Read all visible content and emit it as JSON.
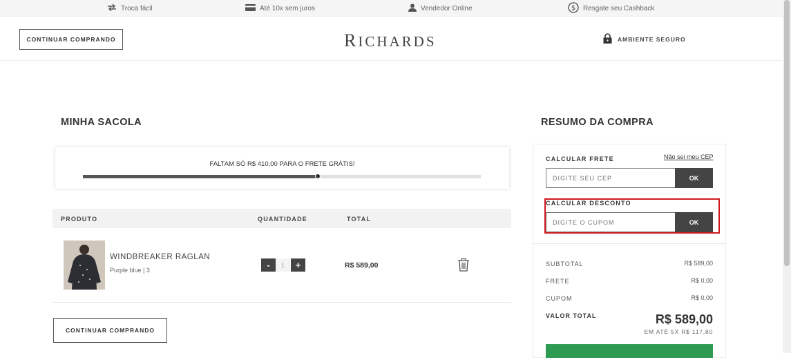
{
  "topbar": {
    "items": [
      {
        "label": "Troca fácil",
        "icon": "swap-arrows-icon"
      },
      {
        "label": "Até 10x sem juros",
        "icon": "credit-card-icon"
      },
      {
        "label": "Vendedor Online",
        "icon": "person-icon"
      },
      {
        "label": "Resgate seu Cashback",
        "icon": "dollar-coin-icon"
      }
    ]
  },
  "header": {
    "continue_label": "CONTINUAR COMPRANDO",
    "logo_first": "R",
    "logo_rest": "ICHARDS",
    "secure_label": "AMBIENTE SEGURO"
  },
  "bag": {
    "title": "MINHA SACOLA",
    "free_shipping_text": "FALTAM SÓ R$ 410,00 PARA O FRETE GRÁTIS!",
    "free_shipping_progress": 0.59,
    "columns": {
      "product": "PRODUTO",
      "quantity": "QUANTIDADE",
      "total": "TOTAL"
    },
    "items": [
      {
        "name": "WINDBREAKER RAGLAN",
        "variant": "Purple blue | 3",
        "quantity": "1",
        "total": "R$ 589,00",
        "minus": "-",
        "plus": "+"
      }
    ],
    "continue_label": "CONTINUAR COMPRANDO"
  },
  "summary": {
    "title": "RESUMO DA COMPRA",
    "shipping_label": "CALCULAR FRETE",
    "cep_link": "Não sei meu CEP",
    "cep_placeholder": "DIGITE SEU CEP",
    "ok_label": "OK",
    "discount_label": "CALCULAR DESCONTO",
    "coupon_placeholder": "DIGITE O CUPOM",
    "subtotal_label": "SUBTOTAL",
    "subtotal_value": "R$ 589,00",
    "frete_label": "FRETE",
    "frete_value": "R$ 0,00",
    "cupom_label": "CUPOM",
    "cupom_value": "R$ 0,00",
    "total_label": "VALOR TOTAL",
    "total_value": "R$ 589,00",
    "installments": "EM ATÉ 5X R$ 117,80"
  },
  "colors": {
    "accent_green": "#2e9b52",
    "highlight_red": "#d0191e",
    "dark_button": "#444444"
  }
}
